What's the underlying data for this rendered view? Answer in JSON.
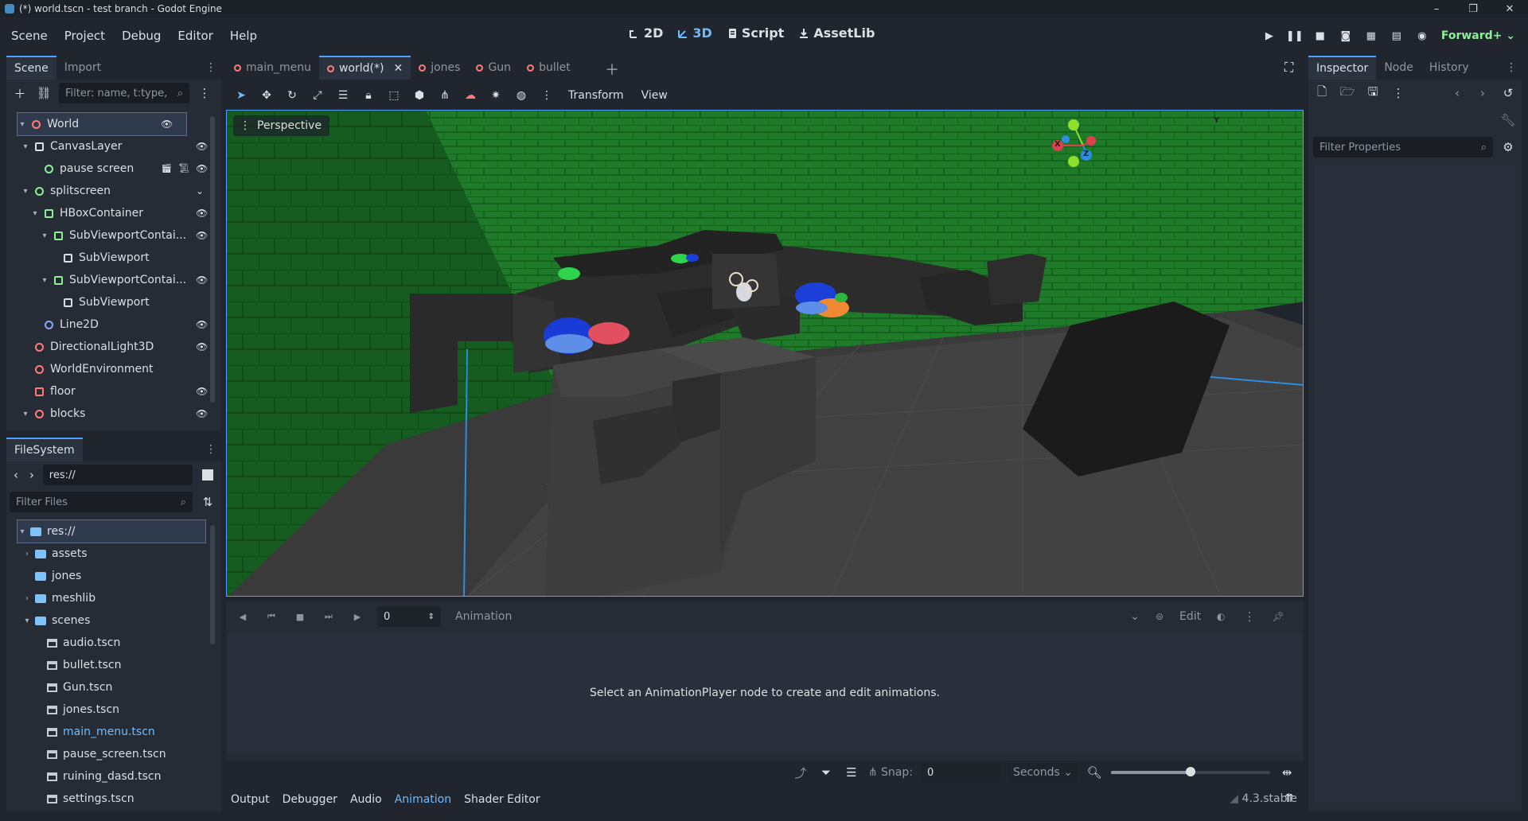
{
  "window": {
    "title": "(*) world.tscn - test branch - Godot Engine",
    "controls": [
      "–",
      "❐",
      "✕"
    ]
  },
  "menu": [
    "Scene",
    "Project",
    "Debug",
    "Editor",
    "Help"
  ],
  "workspaces": [
    {
      "label": "2D",
      "icon": "2d-icon"
    },
    {
      "label": "3D",
      "icon": "3d-icon"
    },
    {
      "label": "Script",
      "icon": "script-icon"
    },
    {
      "label": "AssetLib",
      "icon": "assetlib-icon"
    }
  ],
  "renderer": "Forward+",
  "scene_dock": {
    "tabs": [
      "Scene",
      "Import"
    ],
    "filter_placeholder": "Filter: name, t:type,",
    "nodes": [
      {
        "label": "World",
        "depth": 0,
        "arrow": "▾",
        "icon_color": "#ff7b7b",
        "icon": "node3d",
        "eye": true,
        "selected": true
      },
      {
        "label": "CanvasLayer",
        "depth": 1,
        "arrow": "▾",
        "icon_color": "#dcdfe4",
        "icon": "canvaslayer",
        "eye": true
      },
      {
        "label": "pause screen",
        "depth": 2,
        "arrow": "",
        "icon_color": "#8eef97",
        "icon": "control",
        "eye": true,
        "extras": true
      },
      {
        "label": "splitscreen",
        "depth": 1,
        "arrow": "▾",
        "icon_color": "#8eef97",
        "icon": "control",
        "eye": false,
        "chevron": true
      },
      {
        "label": "HBoxContainer",
        "depth": 2,
        "arrow": "▾",
        "icon_color": "#8eef97",
        "icon": "hbox",
        "eye": true
      },
      {
        "label": "SubViewportContai...",
        "depth": 3,
        "arrow": "▾",
        "icon_color": "#8eef97",
        "icon": "svc",
        "eye": true
      },
      {
        "label": "SubViewport",
        "depth": 4,
        "arrow": "",
        "icon_color": "#dcdfe4",
        "icon": "subviewport",
        "eye": false
      },
      {
        "label": "SubViewportContai...",
        "depth": 3,
        "arrow": "▾",
        "icon_color": "#8eef97",
        "icon": "svc",
        "eye": true
      },
      {
        "label": "SubViewport",
        "depth": 4,
        "arrow": "",
        "icon_color": "#dcdfe4",
        "icon": "subviewport",
        "eye": false
      },
      {
        "label": "Line2D",
        "depth": 2,
        "arrow": "",
        "icon_color": "#8da5f3",
        "icon": "line2d",
        "eye": true
      },
      {
        "label": "DirectionalLight3D",
        "depth": 1,
        "arrow": "",
        "icon_color": "#ff7b7b",
        "icon": "light",
        "eye": true
      },
      {
        "label": "WorldEnvironment",
        "depth": 1,
        "arrow": "",
        "icon_color": "#ff7b7b",
        "icon": "worldenv",
        "eye": false
      },
      {
        "label": "floor",
        "depth": 1,
        "arrow": "",
        "icon_color": "#ff7b7b",
        "icon": "gridmap",
        "eye": true
      },
      {
        "label": "blocks",
        "depth": 1,
        "arrow": "▾",
        "icon_color": "#ff7b7b",
        "icon": "node3d",
        "eye": true
      }
    ]
  },
  "filesystem": {
    "tab": "FileSystem",
    "path": "res://",
    "filter_placeholder": "Filter Files",
    "items": [
      {
        "label": "res://",
        "depth": 0,
        "arrow": "▾",
        "type": "folder",
        "selected": true
      },
      {
        "label": "assets",
        "depth": 1,
        "arrow": "›",
        "type": "folder"
      },
      {
        "label": "jones",
        "depth": 1,
        "arrow": "",
        "type": "folder"
      },
      {
        "label": "meshlib",
        "depth": 1,
        "arrow": "›",
        "type": "folder"
      },
      {
        "label": "scenes",
        "depth": 1,
        "arrow": "▾",
        "type": "folder"
      },
      {
        "label": "audio.tscn",
        "depth": 2,
        "arrow": "",
        "type": "file"
      },
      {
        "label": "bullet.tscn",
        "depth": 2,
        "arrow": "",
        "type": "file"
      },
      {
        "label": "Gun.tscn",
        "depth": 2,
        "arrow": "",
        "type": "file"
      },
      {
        "label": "jones.tscn",
        "depth": 2,
        "arrow": "",
        "type": "file"
      },
      {
        "label": "main_menu.tscn",
        "depth": 2,
        "arrow": "",
        "type": "file",
        "highlight": true
      },
      {
        "label": "pause_screen.tscn",
        "depth": 2,
        "arrow": "",
        "type": "file"
      },
      {
        "label": "ruining_dasd.tscn",
        "depth": 2,
        "arrow": "",
        "type": "file"
      },
      {
        "label": "settings.tscn",
        "depth": 2,
        "arrow": "",
        "type": "file"
      }
    ]
  },
  "editor_tabs": [
    {
      "label": "main_menu",
      "active": false
    },
    {
      "label": "world(*)",
      "active": true
    },
    {
      "label": "jones",
      "active": false
    },
    {
      "label": "Gun",
      "active": false
    },
    {
      "label": "bullet",
      "active": false
    }
  ],
  "viewport_toolbar": {
    "transform_menu": "Transform",
    "view_menu": "View"
  },
  "viewport": {
    "perspective_label": "Perspective",
    "gizmo": {
      "x": "X",
      "y": "Y",
      "z": "Z"
    }
  },
  "animation": {
    "time_value": "0",
    "label": "Animation",
    "edit_label": "Edit",
    "empty_message": "Select an AnimationPlayer node to create and edit animations.",
    "snap_label": "Snap:",
    "snap_value": "0",
    "units": "Seconds",
    "zoom_level": 0.5
  },
  "bottom_tabs": [
    "Output",
    "Debugger",
    "Audio",
    "Animation",
    "Shader Editor"
  ],
  "active_bottom_tab": "Animation",
  "version": "4.3.stable",
  "inspector": {
    "tabs": [
      "Inspector",
      "Node",
      "History"
    ],
    "filter_placeholder": "Filter Properties"
  }
}
